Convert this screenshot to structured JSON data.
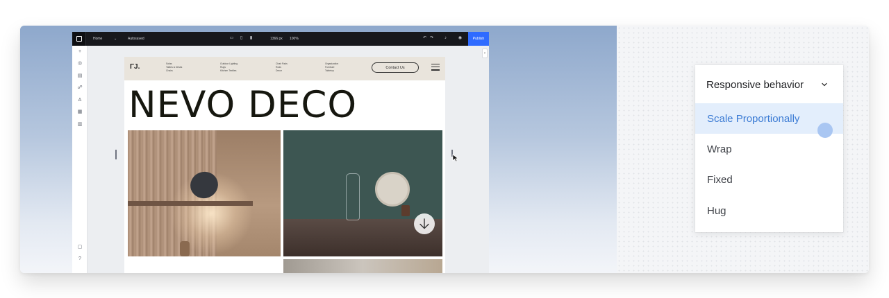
{
  "editor": {
    "topbar": {
      "page": "Home",
      "page_arrow": "⌄",
      "save_status": "Autosaved",
      "width": "1366 px",
      "zoom": "100%",
      "publish": "Publish"
    }
  },
  "site": {
    "logo": "ΓJ.",
    "nav_columns": [
      [
        "Sofas",
        "Tables & Desks",
        "Chairs"
      ],
      [
        "Outdoor Lighting",
        "Rugs",
        "Kitchen Textiles"
      ],
      [
        "Chair Pads",
        "Rods",
        "Decor"
      ],
      [
        "Organization",
        "Furniture",
        "Tabletop"
      ]
    ],
    "contact_button": "Contact Us",
    "hero_title": "NEVO DECO"
  },
  "dropdown": {
    "header": "Responsive behavior",
    "options": [
      "Scale Proportionally",
      "Wrap",
      "Fixed",
      "Hug"
    ],
    "selected_index": 0
  },
  "colors": {
    "publish": "#2f6bff",
    "selected_bg": "#e3eefc",
    "selected_text": "#3b7bd4"
  }
}
